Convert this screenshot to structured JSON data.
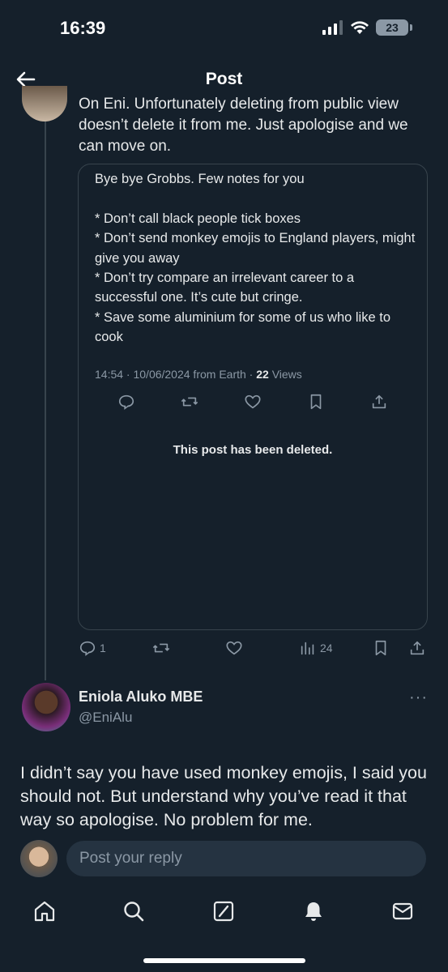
{
  "status_bar": {
    "time": "16:39",
    "battery": "23"
  },
  "header": {
    "title": "Post"
  },
  "reply_post": {
    "text": "On Eni. Unfortunately deleting from public view doesn’t delete it from me. Just apologise and we can move on.",
    "quote": {
      "body": "Bye bye Grobbs. Few notes for you\n\n* Don’t call black people tick boxes\n* Don’t send monkey emojis to England players, might give you away\n* Don’t try compare an irrelevant career to a successful one. It’s cute but cringe.\n* Save some aluminium for some of us who like to cook",
      "meta_prefix": "14:54 · 10/06/2024 from Earth · ",
      "views_count": "22",
      "views_label": " Views",
      "deleted_notice": "This post has been deleted."
    },
    "actions": {
      "replies": "1",
      "views": "24"
    }
  },
  "next_post": {
    "name": "Eniola Aluko MBE",
    "handle": "@EniAlu",
    "more": "···",
    "text": "I didn’t say you have used monkey emojis, I said you should not. But understand why you’ve read it that way so apologise. No problem for me."
  },
  "reply_bar": {
    "placeholder": "Post your reply"
  },
  "nav": [
    "home-icon",
    "search-icon",
    "grok-icon",
    "notifications-icon",
    "messages-icon"
  ],
  "colors": {
    "background": "#15202b",
    "secondary": "#8b98a5",
    "border": "#38444d"
  }
}
